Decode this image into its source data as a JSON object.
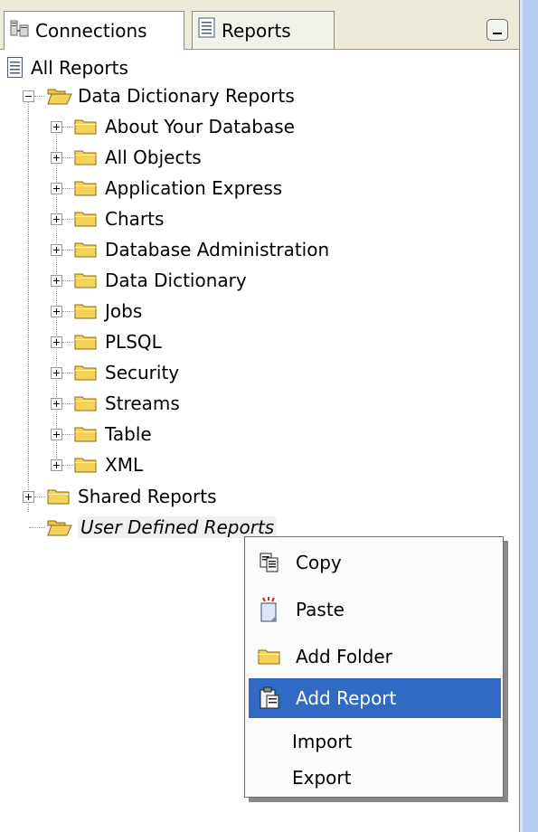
{
  "tabs": {
    "connections_label": "Connections",
    "reports_label": "Reports"
  },
  "tree": {
    "root_label": "All Reports",
    "dictionary_label": "Data Dictionary Reports",
    "dictionary_children": [
      "About Your Database",
      "All Objects",
      "Application Express",
      "Charts",
      "Database Administration",
      "Data Dictionary",
      "Jobs",
      "PLSQL",
      "Security",
      "Streams",
      "Table",
      "XML"
    ],
    "shared_label": "Shared Reports",
    "user_defined_label": "User Defined Reports"
  },
  "context_menu": {
    "copy_label": "Copy",
    "paste_label": "Paste",
    "add_folder_label": "Add Folder",
    "add_report_label": "Add Report",
    "import_label": "Import",
    "export_label": "Export"
  },
  "colors": {
    "highlight": "#316ac5",
    "folder": "#f3d35a",
    "right_panel": "#b4cdf0"
  },
  "icons": {
    "connections": "connections-icon",
    "reports": "report-doc-icon",
    "folder": "folder-icon",
    "open_folder": "open-folder-icon",
    "copy": "copy-icon",
    "paste": "paste-icon",
    "add_report": "clipboard-icon"
  }
}
